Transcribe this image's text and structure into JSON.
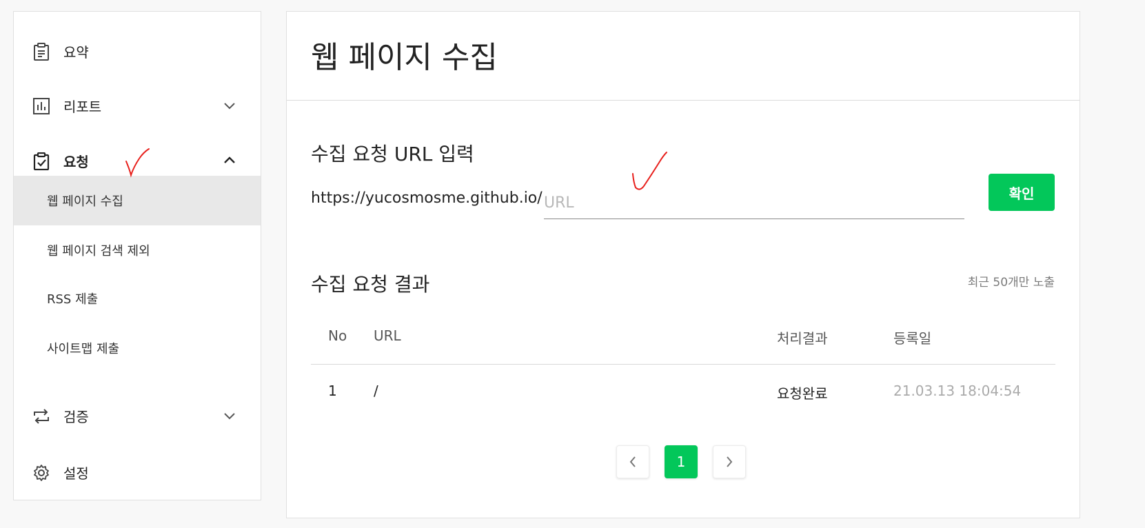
{
  "sidebar": {
    "items": [
      {
        "label": "요약",
        "icon": "clipboard-icon"
      },
      {
        "label": "리포트",
        "icon": "chart-icon",
        "expanded": false
      },
      {
        "label": "요청",
        "icon": "clipboard-check-icon",
        "expanded": true,
        "children": [
          "웹 페이지 수집",
          "웹 페이지 검색 제외",
          "RSS 제출",
          "사이트맵 제출"
        ],
        "active_child": 0
      },
      {
        "label": "검증",
        "icon": "repeat-icon",
        "expanded": false
      },
      {
        "label": "설정",
        "icon": "gear-icon"
      }
    ]
  },
  "main": {
    "title": "웹 페이지 수집",
    "request_section": {
      "title": "수집 요청 URL 입력",
      "url_prefix": "https://yucosmosme.github.io/",
      "input_placeholder": "URL",
      "input_value": "",
      "confirm_label": "확인"
    },
    "results_section": {
      "title": "수집 요청 결과",
      "note": "최근 50개만 노출",
      "columns": [
        "No",
        "URL",
        "처리결과",
        "등록일"
      ],
      "rows": [
        {
          "no": "1",
          "url": "/",
          "status": "요청완료",
          "date": "21.03.13 18:04:54"
        }
      ]
    },
    "pagination": {
      "current": "1"
    }
  },
  "colors": {
    "accent": "#03c75a",
    "annotation": "#e8201c"
  }
}
